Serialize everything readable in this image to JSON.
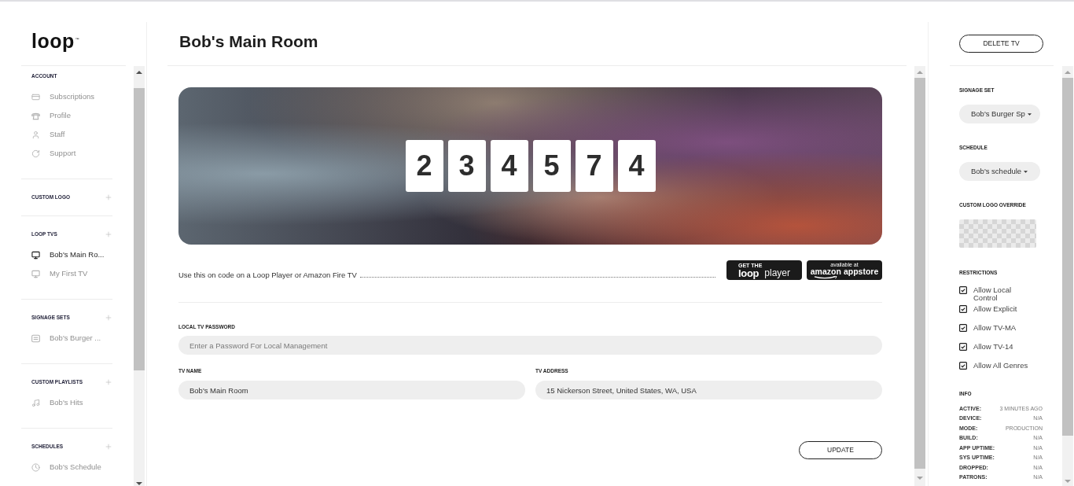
{
  "sidebar": {
    "logo": {
      "text": "loop",
      "mark": "™"
    },
    "sections": [
      {
        "title": "ACCOUNT",
        "addable": false,
        "items": [
          {
            "kind": "billing",
            "label": "Subscriptions",
            "selected": false
          },
          {
            "kind": "profile",
            "label": "Profile",
            "selected": false
          },
          {
            "kind": "staff",
            "label": "Staff",
            "selected": false
          },
          {
            "kind": "support",
            "label": "Support",
            "selected": false
          }
        ]
      },
      {
        "title": "CUSTOM LOGO",
        "addable": true
      },
      {
        "title": "LOOP TVS",
        "addable": true,
        "items": [
          {
            "kind": "tv",
            "label": "Bob's Main Ro...",
            "selected": true
          },
          {
            "kind": "tv",
            "label": "My First TV",
            "selected": false
          }
        ]
      },
      {
        "title": "SIGNAGE SETS",
        "addable": true,
        "items": [
          {
            "kind": "signage",
            "label": "Bob's Burger ...",
            "selected": false
          }
        ]
      },
      {
        "title": "CUSTOM PLAYLISTS",
        "addable": true,
        "items": [
          {
            "kind": "playlist",
            "label": "Bob's Hits",
            "selected": false
          }
        ]
      },
      {
        "title": "SCHEDULES",
        "addable": true,
        "items": [
          {
            "kind": "schedule",
            "label": "Bob's Schedule",
            "selected": false
          }
        ]
      }
    ]
  },
  "main": {
    "title": "Bob's Main Room",
    "code": [
      "2",
      "3",
      "4",
      "5",
      "7",
      "4"
    ],
    "instruction": "Use this on code on a Loop Player or Amazon Fire TV",
    "badges": [
      {
        "kind": "loop",
        "top": "GET THE",
        "brand": "loop",
        "product": "player"
      },
      {
        "kind": "amazon",
        "top": "available at",
        "brand": "amazon",
        "product": "appstore"
      }
    ],
    "password": {
      "label": "LOCAL TV PASSWORD",
      "placeholder": "Enter a Password For Local Management"
    },
    "fields": [
      {
        "label": "TV NAME",
        "value": "Bob's Main Room"
      },
      {
        "label": "TV ADDRESS",
        "value": "15 Nickerson Street, United States, WA, USA"
      }
    ],
    "button": "UPDATE"
  },
  "details": {
    "button": "DELETE TV",
    "selects": [
      {
        "label": "SIGNAGE SET",
        "value": "Bob's Burger Sp"
      },
      {
        "label": "SCHEDULE",
        "value": "Bob's schedule"
      }
    ],
    "custom_logo": {
      "label": "CUSTOM LOGO OVERRIDE"
    },
    "restrictions": {
      "label": "RESTRICTIONS",
      "items": [
        {
          "label": "Allow Local Control",
          "checked": true
        },
        {
          "label": "Allow Explicit",
          "checked": true
        },
        {
          "label": "Allow TV-MA",
          "checked": true
        },
        {
          "label": "Allow TV-14",
          "checked": true
        },
        {
          "label": "Allow All Genres",
          "checked": true
        }
      ]
    },
    "info": {
      "label": "INFO",
      "rows": [
        {
          "label": "ACTIVE:",
          "value": "3 MINUTES AGO"
        },
        {
          "label": "DEVICE:",
          "value": "N/A"
        },
        {
          "label": "MODE:",
          "value": "PRODUCTION"
        },
        {
          "label": "BUILD:",
          "value": "N/A"
        },
        {
          "label": "APP UPTIME:",
          "value": "N/A"
        },
        {
          "label": "SYS UPTIME:",
          "value": "N/A"
        },
        {
          "label": "DROPPED:",
          "value": "N/A"
        },
        {
          "label": "PATRONS:",
          "value": "N/A"
        }
      ]
    }
  }
}
